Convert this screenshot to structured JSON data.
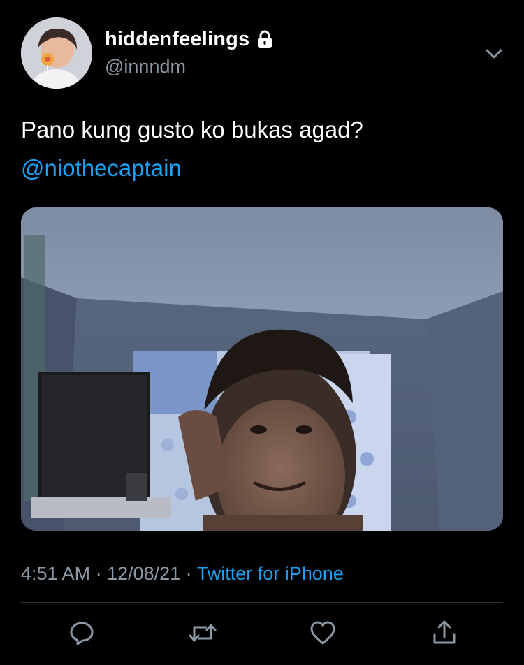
{
  "tweet": {
    "display_name": "hiddenfeelings",
    "handle": "@innndm",
    "text": "Pano kung gusto ko bukas agad?",
    "mention": "@niothecaptain",
    "time": "4:51 AM",
    "separator": " · ",
    "date": "12/08/21",
    "source": "Twitter for iPhone",
    "protected_icon": "lock-icon"
  },
  "actions": [
    {
      "icon": "reply-icon"
    },
    {
      "icon": "retweet-icon"
    },
    {
      "icon": "like-icon"
    },
    {
      "icon": "share-icon"
    }
  ],
  "colors": {
    "background": "#000000",
    "text": "#ffffff",
    "secondary": "#8b98a5",
    "link": "#1da1f2",
    "divider": "#2f3336"
  }
}
